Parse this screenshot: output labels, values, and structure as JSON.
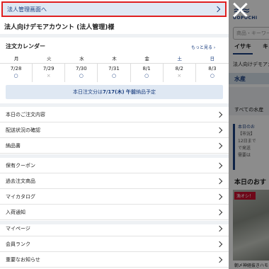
{
  "background": {
    "logo": "UOPOCHI",
    "search_placeholder": "商品・キーワード",
    "nav": [
      "イサキ",
      "キン"
    ],
    "account": "法人向けデモアカウ",
    "category": "水産",
    "fish_label": "すべての水産",
    "notice_title": "本日のお",
    "notice_lines": [
      "【市況】",
      "12日まで",
      "で発送",
      "需要は"
    ],
    "today_title": "本日のおす",
    "badge": "漁オシ！",
    "caption": "朝〆神経抜きハモ"
  },
  "drawer": {
    "corp_link": "法人管理画面へ",
    "account_name": "法人向けデモアカウント (法人管理)様",
    "calendar": {
      "title": "注文カレンダー",
      "more": "もっと見る ›",
      "days": [
        "月",
        "火",
        "水",
        "木",
        "金",
        "土",
        "日"
      ],
      "dates": [
        "7/28",
        "7/29",
        "7/30",
        "7/31",
        "8/1",
        "8/2",
        "8/3"
      ],
      "marks": [
        "○",
        "×",
        "○",
        "○",
        "○",
        "×",
        "○"
      ]
    },
    "order_notice_prefix": "本日注文分は",
    "order_notice_bold": "7/17(木) 午前",
    "order_notice_suffix": "納品予定",
    "menu_group1": [
      "本日のご注文内容",
      "配送状況の確認",
      "納品書"
    ],
    "menu_group2": [
      "保有クーポン",
      "過去注文商品",
      "マイカタログ",
      "入荷通知"
    ],
    "menu_group3": [
      "マイページ",
      "会員ランク",
      "重要なお知らせ"
    ]
  }
}
